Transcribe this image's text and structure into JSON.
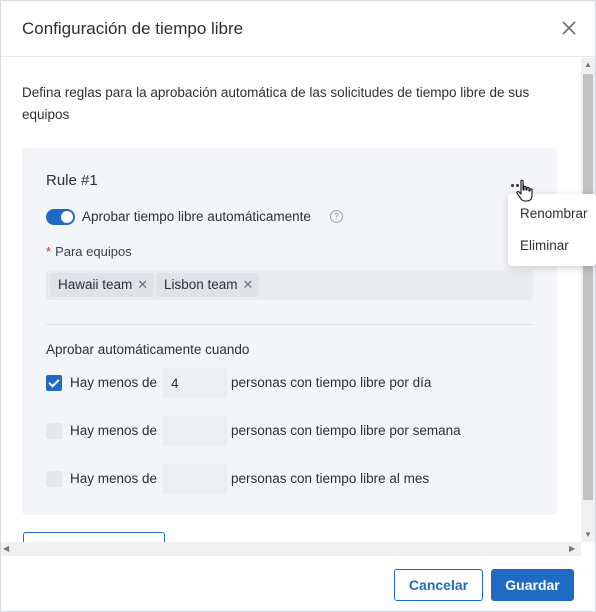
{
  "dialog": {
    "title": "Configuración de tiempo libre",
    "description": "Defina reglas para la aprobación automática de las solicitudes de tiempo libre de sus equipos"
  },
  "rule": {
    "title": "Rule #1",
    "toggle_label": "Aprobar tiempo libre automáticamente",
    "toggle_on": true,
    "teams_label": "Para equipos",
    "required_mark": "*",
    "teams": [
      "Hawaii team",
      "Lisbon team"
    ],
    "conditions_label": "Aprobar automáticamente cuando",
    "conditions": [
      {
        "prefix": "Hay menos de",
        "value": "4",
        "suffix": "personas con tiempo libre por día",
        "checked": true
      },
      {
        "prefix": "Hay menos de",
        "value": "",
        "suffix": "personas con tiempo libre por semana",
        "checked": false
      },
      {
        "prefix": "Hay menos de",
        "value": "",
        "suffix": "personas con tiempo libre al mes",
        "checked": false
      }
    ]
  },
  "context_menu": {
    "items": [
      "Renombrar",
      "Eliminar"
    ]
  },
  "footer": {
    "cancel_label": "Cancelar",
    "save_label": "Guardar"
  },
  "colors": {
    "accent": "#1f6bc4",
    "card_bg": "#f4f5f8",
    "required": "#d0342c"
  },
  "icons": [
    "close-icon",
    "more-dots-icon",
    "help-icon",
    "tag-remove-icon",
    "checkmark-icon",
    "hand-cursor-icon"
  ]
}
